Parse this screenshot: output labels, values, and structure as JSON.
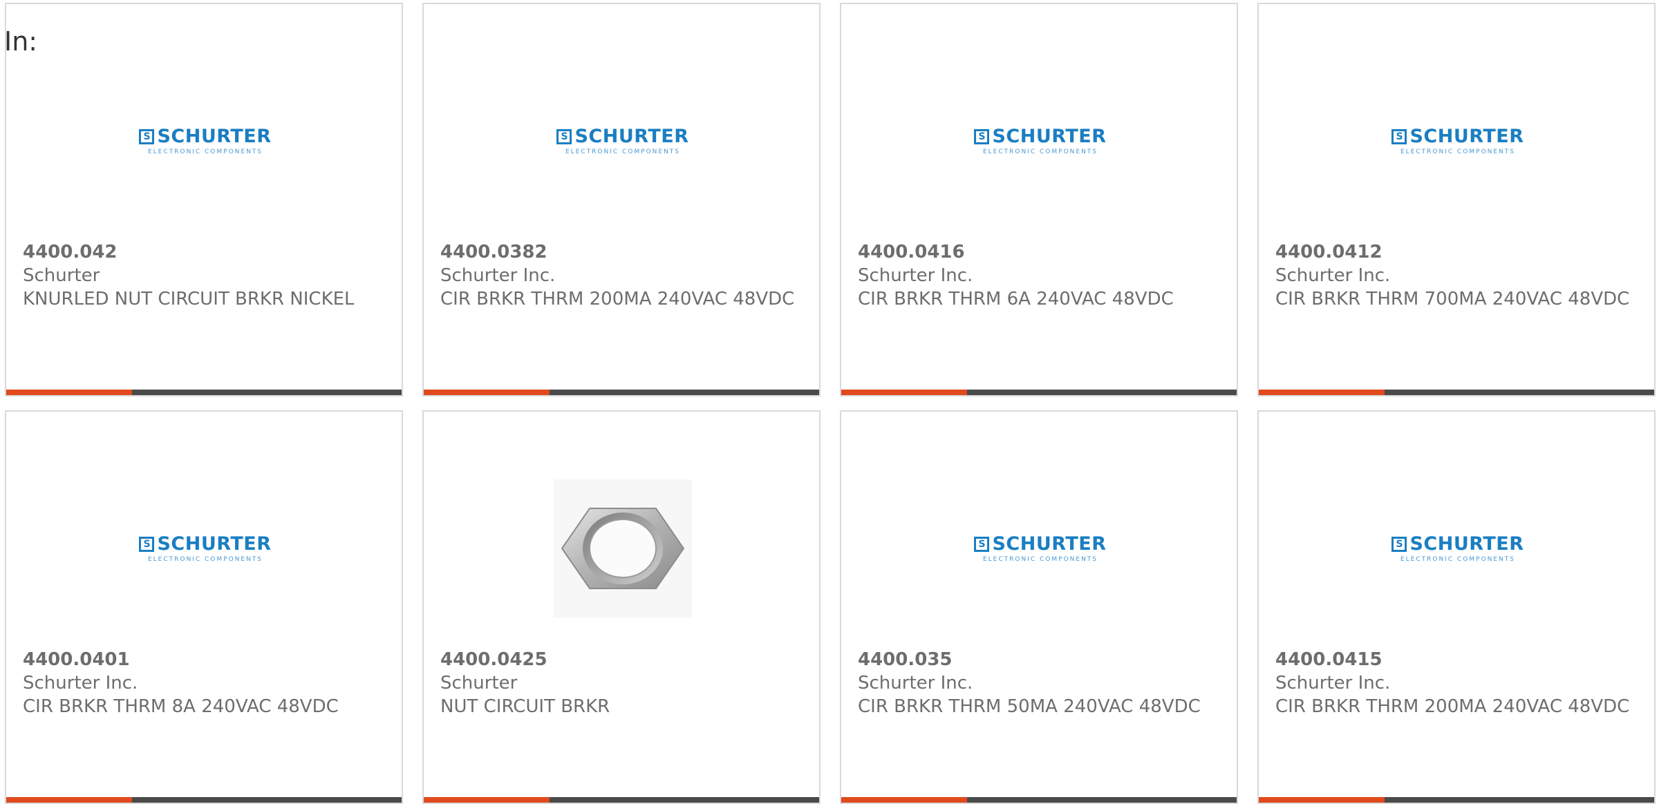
{
  "header": {
    "label": "In:"
  },
  "colors": {
    "accent": "#e04a1c",
    "bar": "#4a4a4a",
    "text": "#6d6d6d",
    "brand": "#1a7ec2",
    "border": "#d9d9d9"
  },
  "brand_logo": {
    "word": "SCHURTER",
    "mark": "S",
    "tagline": "ELECTRONIC COMPONENTS"
  },
  "products": [
    {
      "part_number": "4400.042",
      "manufacturer": "Schurter",
      "description": "KNURLED NUT CIRCUIT BRKR NICKEL",
      "image": "schurter-logo"
    },
    {
      "part_number": "4400.0382",
      "manufacturer": "Schurter Inc.",
      "description": "CIR BRKR THRM 200MA 240VAC 48VDC",
      "image": "schurter-logo"
    },
    {
      "part_number": "4400.0416",
      "manufacturer": "Schurter Inc.",
      "description": "CIR BRKR THRM 6A 240VAC 48VDC",
      "image": "schurter-logo"
    },
    {
      "part_number": "4400.0412",
      "manufacturer": "Schurter Inc.",
      "description": "CIR BRKR THRM 700MA 240VAC 48VDC",
      "image": "schurter-logo"
    },
    {
      "part_number": "4400.0401",
      "manufacturer": "Schurter Inc.",
      "description": "CIR BRKR THRM 8A 240VAC 48VDC",
      "image": "schurter-logo"
    },
    {
      "part_number": "4400.0425",
      "manufacturer": "Schurter",
      "description": "NUT CIRCUIT BRKR",
      "image": "hex-nut-photo"
    },
    {
      "part_number": "4400.035",
      "manufacturer": "Schurter Inc.",
      "description": "CIR BRKR THRM 50MA 240VAC 48VDC",
      "image": "schurter-logo"
    },
    {
      "part_number": "4400.0415",
      "manufacturer": "Schurter Inc.",
      "description": "CIR BRKR THRM 200MA 240VAC 48VDC",
      "image": "schurter-logo"
    }
  ]
}
